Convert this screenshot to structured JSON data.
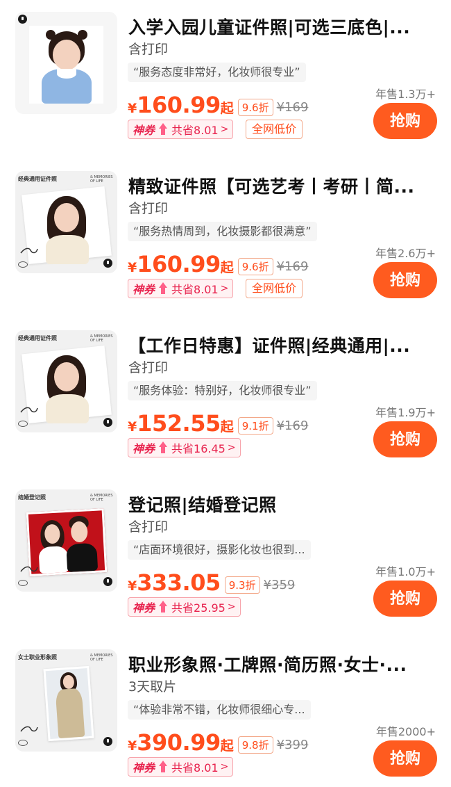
{
  "products": [
    {
      "title": "入学入园儿童证件照|可选三底色|...",
      "subtitle": "含打印",
      "review": "“服务态度非常好，化妆师很专业”",
      "currency": "¥",
      "price": "160.99",
      "price_suffix": "起",
      "discount": "9.6折",
      "original_price": "¥169",
      "coupon_label": "神券",
      "coupon_save": "共省8.01",
      "lowest_label": "全网低价",
      "sold": "年售1.3万+",
      "buy_label": "抢购"
    },
    {
      "title": "精致证件照【可选艺考丨考研丨简...",
      "subtitle": "含打印",
      "review": "“服务热情周到，化妆摄影都很满意”",
      "currency": "¥",
      "price": "160.99",
      "price_suffix": "起",
      "discount": "9.6折",
      "original_price": "¥169",
      "coupon_label": "神券",
      "coupon_save": "共省8.01",
      "lowest_label": "全网低价",
      "sold": "年售2.6万+",
      "buy_label": "抢购",
      "thumb_title": "经典通用证件照",
      "thumb_eng": "& MEMORIES OF LIFE"
    },
    {
      "title": "【工作日特惠】证件照|经典通用|...",
      "subtitle": "含打印",
      "review": "“服务体验：特别好，化妆师很专业”",
      "currency": "¥",
      "price": "152.55",
      "price_suffix": "起",
      "discount": "9.1折",
      "original_price": "¥169",
      "coupon_label": "神券",
      "coupon_save": "共省16.45",
      "sold": "年售1.9万+",
      "buy_label": "抢购",
      "thumb_title": "经典通用证件照",
      "thumb_eng": "& MEMORIES OF LIFE"
    },
    {
      "title": "登记照|结婚登记照",
      "subtitle": "含打印",
      "review": "“店面环境很好，摄影化妆也很到...",
      "currency": "¥",
      "price": "333.05",
      "price_suffix": "",
      "discount": "9.3折",
      "original_price": "¥359",
      "coupon_label": "神券",
      "coupon_save": "共省25.95",
      "sold": "年售1.0万+",
      "buy_label": "抢购",
      "thumb_title": "结婚登记照",
      "thumb_eng": "& MEMORIES OF LIFE"
    },
    {
      "title": "职业形象照·工牌照·简历照·女士·...",
      "subtitle": "3天取片",
      "review": "“体验非常不错，化妆师很细心专...",
      "currency": "¥",
      "price": "390.99",
      "price_suffix": "起",
      "discount": "9.8折",
      "original_price": "¥399",
      "coupon_label": "神券",
      "coupon_save": "共省8.01",
      "sold": "年售2000+",
      "buy_label": "抢购",
      "thumb_title": "女士职业形象照",
      "thumb_eng": "& MEMORIES OF LIFE"
    }
  ],
  "colors": {
    "accent": "#ff4d1c",
    "buy_button": "#ff5b1f",
    "coupon": "#e8234e"
  }
}
